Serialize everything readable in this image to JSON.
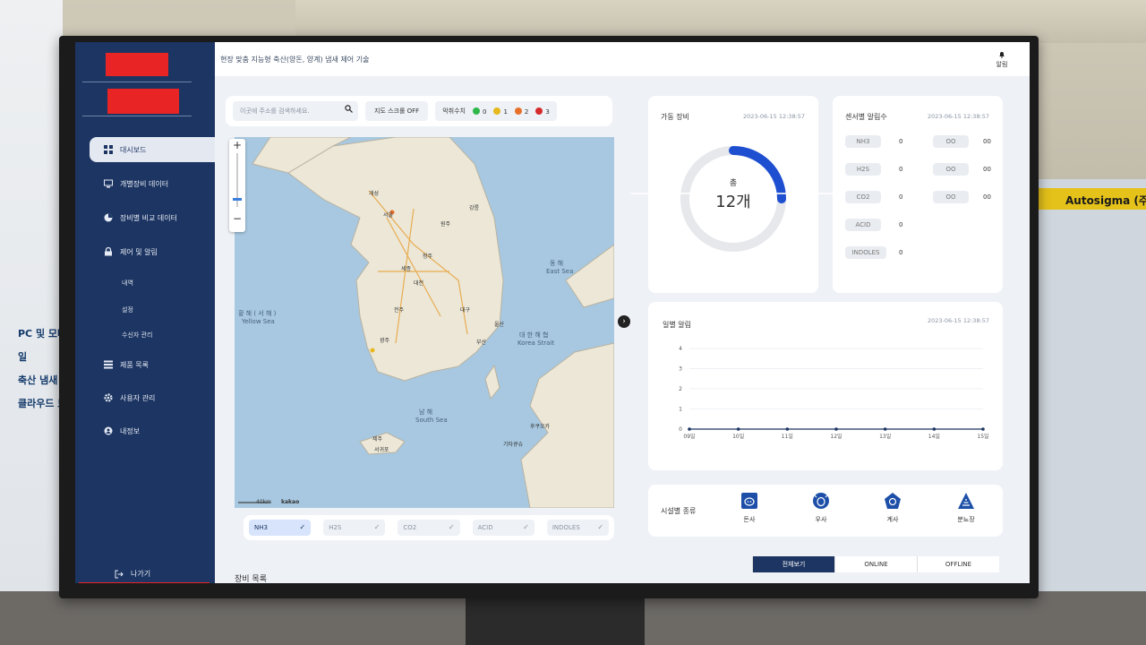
{
  "page_title": "현장 맞춤 지능형 축산(양돈, 양계) 냄새 제어 기술",
  "header": {
    "bell_label": "알림"
  },
  "sidebar": {
    "items": [
      {
        "label": "대시보드",
        "icon": "grid-icon"
      },
      {
        "label": "개별장비 데이터",
        "icon": "monitor-icon"
      },
      {
        "label": "장비별 비교 데이터",
        "icon": "pie-chart-icon"
      },
      {
        "label": "제어 및 알림",
        "icon": "lock-icon"
      },
      {
        "label": "제품 목록",
        "icon": "list-icon"
      },
      {
        "label": "사용자 관리",
        "icon": "gear-icon"
      },
      {
        "label": "내정보",
        "icon": "user-icon"
      }
    ],
    "subitems": [
      "내역",
      "설정",
      "수신자 관리"
    ],
    "logout_label": "나가기"
  },
  "map_toolbar": {
    "search_placeholder": "이곳에 주소를 검색하세요.",
    "scroll_toggle": "지도 스크롤 OFF",
    "odor_label": "악취수치",
    "odor_levels": [
      {
        "color": "#2fb84a",
        "count": "0"
      },
      {
        "color": "#e6b81c",
        "count": "1"
      },
      {
        "color": "#e8702a",
        "count": "2"
      },
      {
        "color": "#d62b2b",
        "count": "3"
      }
    ]
  },
  "map": {
    "labels": {
      "east_sea_ko": "동 해",
      "east_sea_en": "East Sea",
      "yellow_sea_ko": "황 해 ( 서 해 )",
      "yellow_sea_en": "Yellow Sea",
      "south_sea_ko": "남 해",
      "south_sea_en": "South Sea",
      "korea_strait_ko": "대 한 해 협",
      "korea_strait_en": "Korea Strait"
    },
    "cities": [
      "서울",
      "개성",
      "세종",
      "대전",
      "대구",
      "울산",
      "부산",
      "광주",
      "전주",
      "청주",
      "원주",
      "강릉",
      "제주",
      "서귀포",
      "후쿠오카",
      "기타큐슈"
    ],
    "scale_label": "40km",
    "provider": "kakao"
  },
  "sensor_chips": [
    {
      "label": "NH3",
      "on": true
    },
    {
      "label": "H2S",
      "on": false
    },
    {
      "label": "CO2",
      "on": false
    },
    {
      "label": "ACID",
      "on": false
    },
    {
      "label": "INDOLES",
      "on": false
    }
  ],
  "device_card": {
    "title": "가동 장비",
    "timestamp": "2023-06-15 12:38:57",
    "total_label": "총",
    "total_value": "12개",
    "active_fraction": 0.25
  },
  "alert_card": {
    "title": "센서별 알림수",
    "timestamp": "2023-06-15 12:38:57",
    "rows": [
      {
        "name": "NH3",
        "value": "0",
        "name2": "OO",
        "value2": "00"
      },
      {
        "name": "H2S",
        "value": "0",
        "name2": "OO",
        "value2": "00"
      },
      {
        "name": "CO2",
        "value": "0",
        "name2": "OO",
        "value2": "00"
      },
      {
        "name": "ACID",
        "value": "0"
      },
      {
        "name": "INDOLES",
        "value": "0"
      }
    ]
  },
  "daily_card": {
    "title": "일별 알림",
    "timestamp": "2023-06-15 12:38:57"
  },
  "chart_data": {
    "type": "line",
    "categories": [
      "09일",
      "10일",
      "11일",
      "12일",
      "13일",
      "14일",
      "15일"
    ],
    "values": [
      0,
      0,
      0,
      0,
      0,
      0,
      0
    ],
    "yticks": [
      "0",
      "1",
      "2",
      "3",
      "4"
    ],
    "ylim": [
      0,
      4
    ]
  },
  "facility_card": {
    "title": "시설별 종류",
    "items": [
      {
        "label": "돈사",
        "icon": "pig-icon"
      },
      {
        "label": "우사",
        "icon": "cow-icon"
      },
      {
        "label": "계사",
        "icon": "chicken-icon"
      },
      {
        "label": "분뇨장",
        "icon": "manure-icon"
      }
    ]
  },
  "filter_tabs": [
    "전체보기",
    "ONLINE",
    "OFFLINE"
  ],
  "device_list_title": "장비 목록",
  "colors": {
    "sidebar": "#1d3562",
    "accent": "#1f4fd1",
    "redact": "#e82424"
  }
}
